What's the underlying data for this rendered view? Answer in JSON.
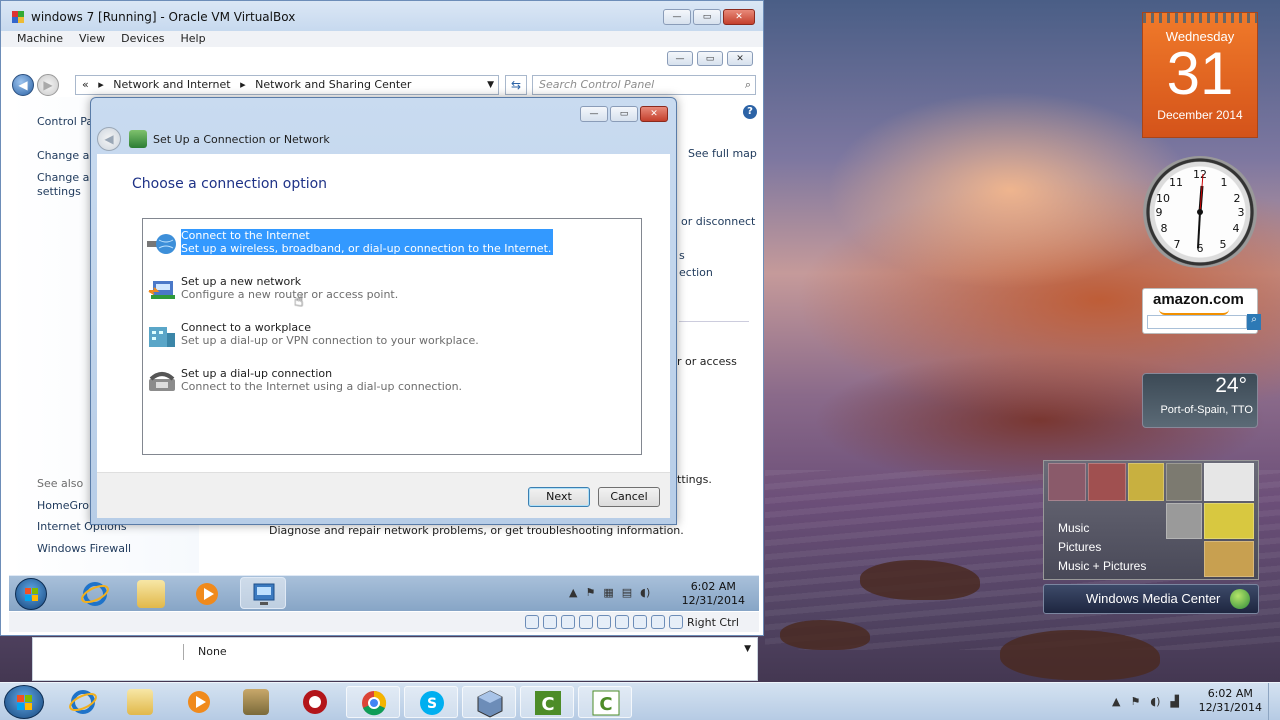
{
  "vbox": {
    "title": "windows 7 [Running] - Oracle VM VirtualBox",
    "menu": [
      "Machine",
      "View",
      "Devices",
      "Help"
    ],
    "status_host_key": "Right Ctrl"
  },
  "explorer": {
    "breadcrumb_root": "«",
    "breadcrumb": [
      "Network and Internet",
      "Network and Sharing Center"
    ],
    "search_placeholder": "Search Control Panel",
    "left_pane": {
      "control_panel": "Control Pa",
      "link1": "Change ad",
      "link2a": "Change ad",
      "link2b": "settings",
      "see_also": "See also",
      "see_also_items": [
        "HomeGrou",
        "Internet Options",
        "Windows Firewall"
      ]
    },
    "right_fragments": {
      "see_full_map": "See full map",
      "or_disconnect": "or disconnect",
      "s": "s",
      "ection": "ection",
      "or_access": "r or access",
      "ttings": "ttings.",
      "diagnose": "Diagnose and repair network problems, or get troubleshooting information."
    },
    "bottom_field": "None"
  },
  "dialog": {
    "title": "Set Up a Connection or Network",
    "heading": "Choose a connection option",
    "options": [
      {
        "title": "Connect to the Internet",
        "desc": "Set up a wireless, broadband, or dial-up connection to the Internet.",
        "icon": "globe-network-icon"
      },
      {
        "title": "Set up a new network",
        "desc": "Configure a new router or access point.",
        "icon": "router-icon"
      },
      {
        "title": "Connect to a workplace",
        "desc": "Set up a dial-up or VPN connection to your workplace.",
        "icon": "workplace-icon"
      },
      {
        "title": "Set up a dial-up connection",
        "desc": "Connect to the Internet using a dial-up connection.",
        "icon": "phone-icon"
      }
    ],
    "next_label": "Next",
    "cancel_label": "Cancel"
  },
  "guest_taskbar": {
    "time": "6:02 AM",
    "date": "12/31/2014"
  },
  "gadgets": {
    "calendar": {
      "weekday": "Wednesday",
      "day": "31",
      "month_year": "December 2014"
    },
    "amazon_logo": "amazon.com",
    "weather": {
      "temp": "24°",
      "city": "Port-of-Spain, TTO"
    },
    "media_center": {
      "menu": [
        "Music",
        "Pictures",
        "Music + Pictures"
      ],
      "bar_label": "Windows Media Center"
    }
  },
  "host_taskbar": {
    "time": "6:02 AM",
    "date": "12/31/2014"
  },
  "colors": {
    "selection": "#3399ff",
    "dialog_heading": "#1e3287",
    "calendar_orange": "#e8672a"
  }
}
